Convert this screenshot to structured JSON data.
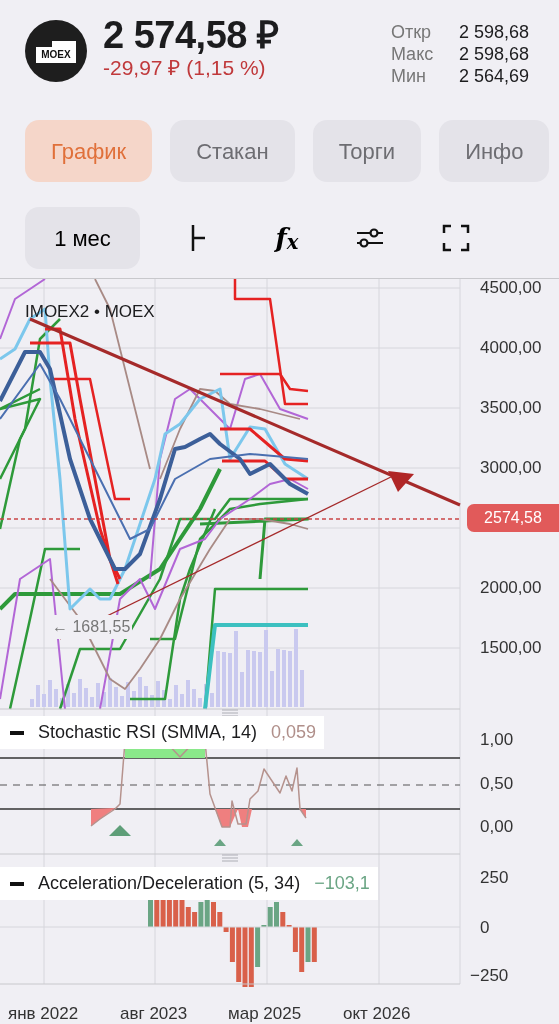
{
  "header": {
    "logo": "MOEX",
    "price": "2 574,58 ₽",
    "change": "-29,97 ₽ (1,15 %)",
    "stats": [
      {
        "label": "Откр",
        "value": "2 598,68"
      },
      {
        "label": "Макс",
        "value": "2 598,68"
      },
      {
        "label": "Мин",
        "value": "2 564,69"
      }
    ]
  },
  "tabs": [
    {
      "label": "График",
      "selected": true
    },
    {
      "label": "Стакан",
      "selected": false
    },
    {
      "label": "Торги",
      "selected": false
    },
    {
      "label": "Инфо",
      "selected": false
    }
  ],
  "toolbar": {
    "period": "1 мес",
    "tools": [
      {
        "kind": "crosshair"
      },
      {
        "kind": "function",
        "label": "f$_{x}$"
      },
      {
        "kind": "settings"
      },
      {
        "kind": "fullscreen"
      }
    ]
  },
  "main_chart": {
    "title": "IMOEX2 • MOEX",
    "yticks": [
      "4500,00",
      "4000,00",
      "3500,00",
      "3000,00",
      "2000,00",
      "1500,00"
    ],
    "price_tag": "2574,58",
    "low_marker": "← 1681,55"
  },
  "indicators": [
    {
      "name": "Stochastic RSI (SMMA, 14)",
      "value": "0,059",
      "color": "#b08f8a",
      "yticks": [
        "1,00",
        "0,50",
        "0,00"
      ]
    },
    {
      "name": "Acceleration/Deceleration (5, 34)",
      "value": "−103,1",
      "color": "#6aa584",
      "yticks": [
        "250",
        "0",
        "−250"
      ]
    }
  ],
  "xaxis": [
    "янв 2022",
    "авг 2023",
    "мар 2025",
    "окт 2026"
  ]
}
